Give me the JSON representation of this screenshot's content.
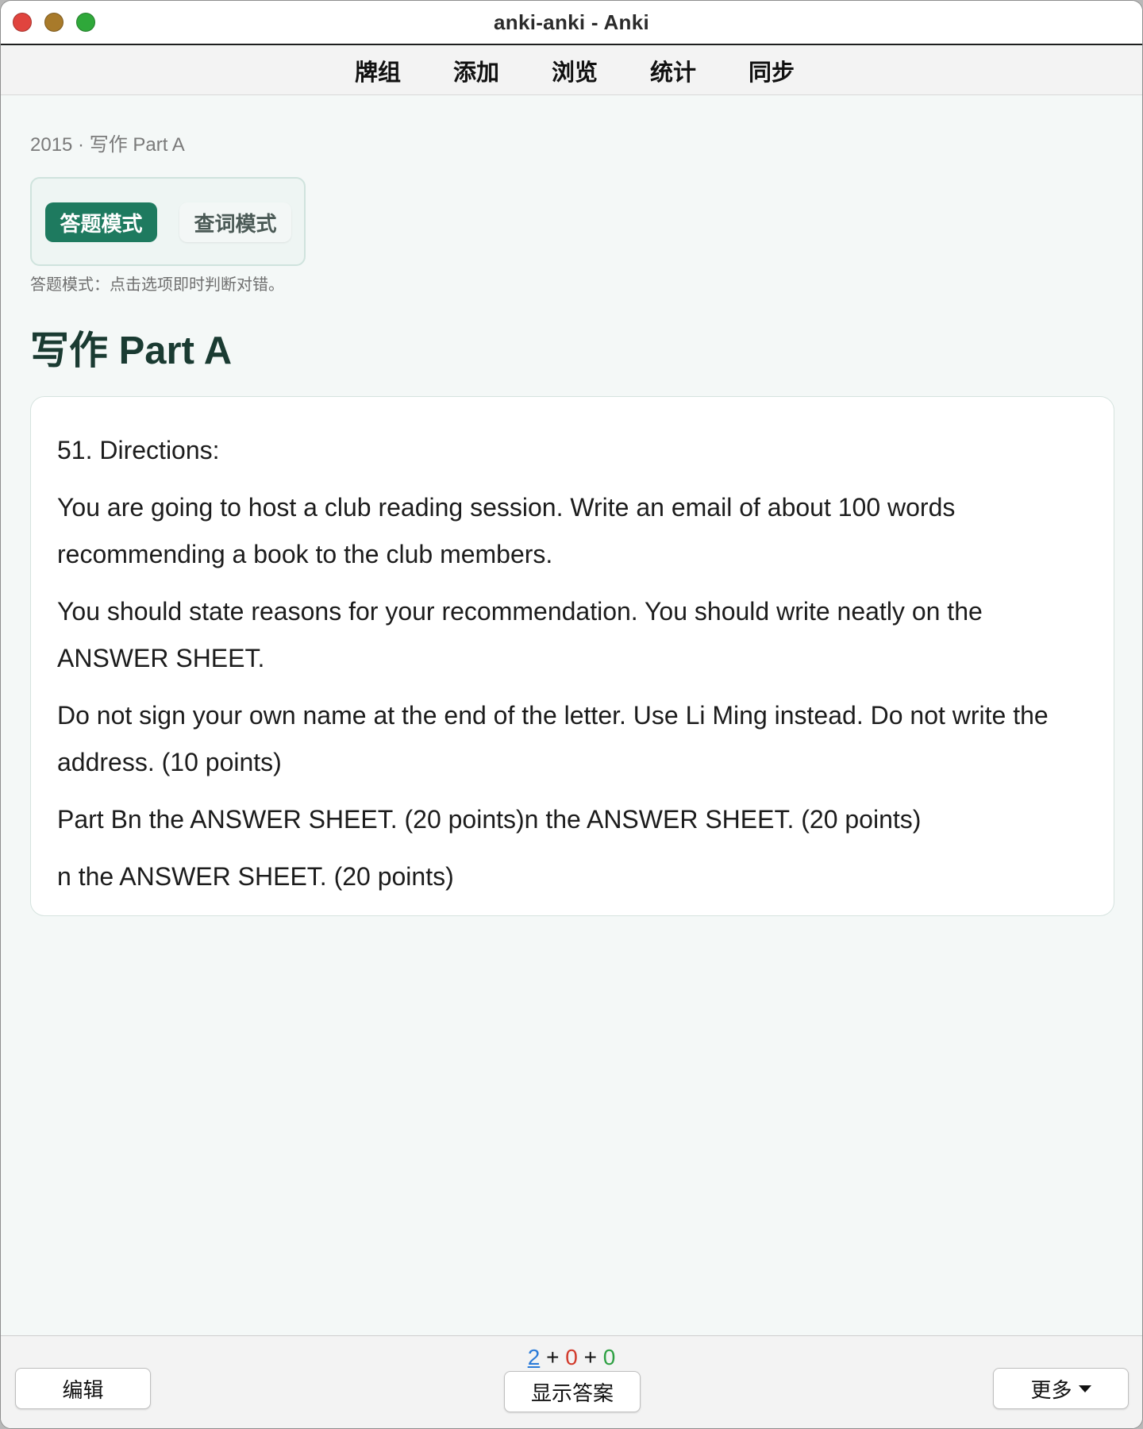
{
  "window": {
    "title": "anki-anki - Anki"
  },
  "topnav": {
    "items": [
      {
        "label": "牌组"
      },
      {
        "label": "添加"
      },
      {
        "label": "浏览"
      },
      {
        "label": "统计"
      },
      {
        "label": "同步"
      }
    ]
  },
  "content": {
    "breadcrumb": "2015 · 写作 Part A",
    "modes": {
      "answer_label": "答题模式",
      "lookup_label": "查词模式",
      "active": "答题模式"
    },
    "mode_hint": "答题模式：点击选项即时判断对错。",
    "heading": "写作 Part A",
    "card": {
      "paragraphs": [
        "51. Directions:",
        "You are going to host a club reading session. Write an email of about 100 words recommending a book to the club members.",
        "You should state reasons for your recommendation. You should write neatly on the ANSWER SHEET.",
        "Do not sign your own name at the end of the letter. Use Li Ming instead. Do not write the address. (10 points)",
        "Part Bn the ANSWER SHEET. (20 points)n the ANSWER SHEET. (20 points)",
        "n the ANSWER SHEET. (20 points)"
      ]
    }
  },
  "bottombar": {
    "counts": {
      "new": "2",
      "learning": "0",
      "review": "0",
      "separator": "+"
    },
    "edit_label": "编辑",
    "show_answer_label": "显示答案",
    "more_label": "更多"
  },
  "colors": {
    "accent": "#1e7a5f",
    "heading": "#1a3b32",
    "new_count": "#2b7bd8",
    "learn_count": "#d23a2b",
    "review_count": "#2ea043"
  }
}
